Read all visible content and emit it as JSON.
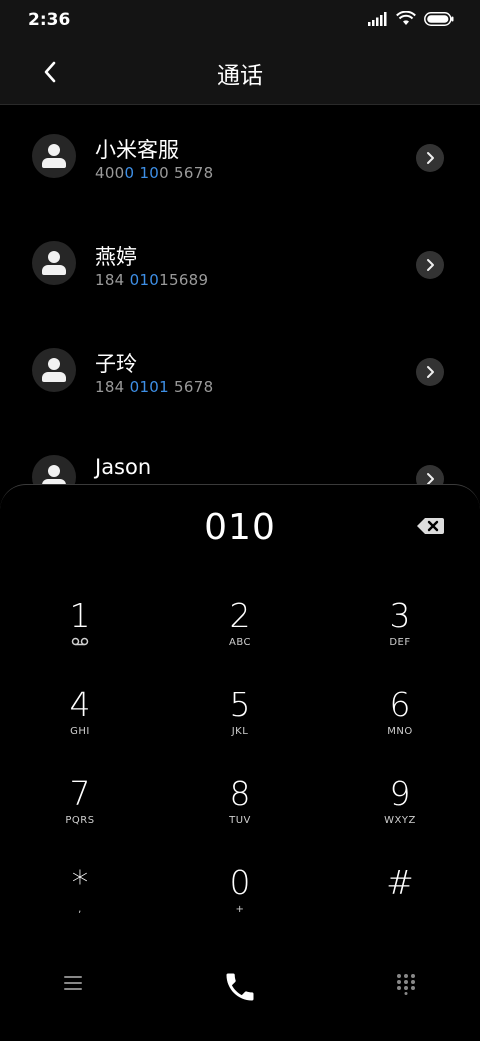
{
  "status": {
    "time": "2:36"
  },
  "header": {
    "title": "通话"
  },
  "contacts": [
    {
      "name": "小米客服",
      "number_parts": [
        "400",
        "0 10",
        "0 5678"
      ]
    },
    {
      "name": "燕婷",
      "number_parts": [
        "184 ",
        "010",
        "15689"
      ]
    },
    {
      "name": "子玲",
      "number_parts": [
        "184 ",
        "0101",
        " 5678"
      ]
    },
    {
      "name": "Jason",
      "number_parts": [
        "",
        "",
        ""
      ]
    }
  ],
  "dialpad": {
    "input": "010",
    "keys": [
      {
        "digit": "1",
        "letters": ""
      },
      {
        "digit": "2",
        "letters": "ABC"
      },
      {
        "digit": "3",
        "letters": "DEF"
      },
      {
        "digit": "4",
        "letters": "GHI"
      },
      {
        "digit": "5",
        "letters": "JKL"
      },
      {
        "digit": "6",
        "letters": "MNO"
      },
      {
        "digit": "7",
        "letters": "PQRS"
      },
      {
        "digit": "8",
        "letters": "TUV"
      },
      {
        "digit": "9",
        "letters": "WXYZ"
      },
      {
        "digit": "*",
        "letters": ","
      },
      {
        "digit": "0",
        "letters": "+"
      },
      {
        "digit": "#",
        "letters": ""
      }
    ]
  },
  "icons": {
    "status": [
      "signal-icon",
      "wifi-icon",
      "battery-icon"
    ],
    "header": [
      "back-arrow-icon"
    ],
    "bottom": [
      "menu-icon",
      "phone-call-icon",
      "dialpad-grid-icon"
    ]
  },
  "colors": {
    "highlight": "#3e8fe6",
    "background": "#000000",
    "surface": "#141414"
  }
}
